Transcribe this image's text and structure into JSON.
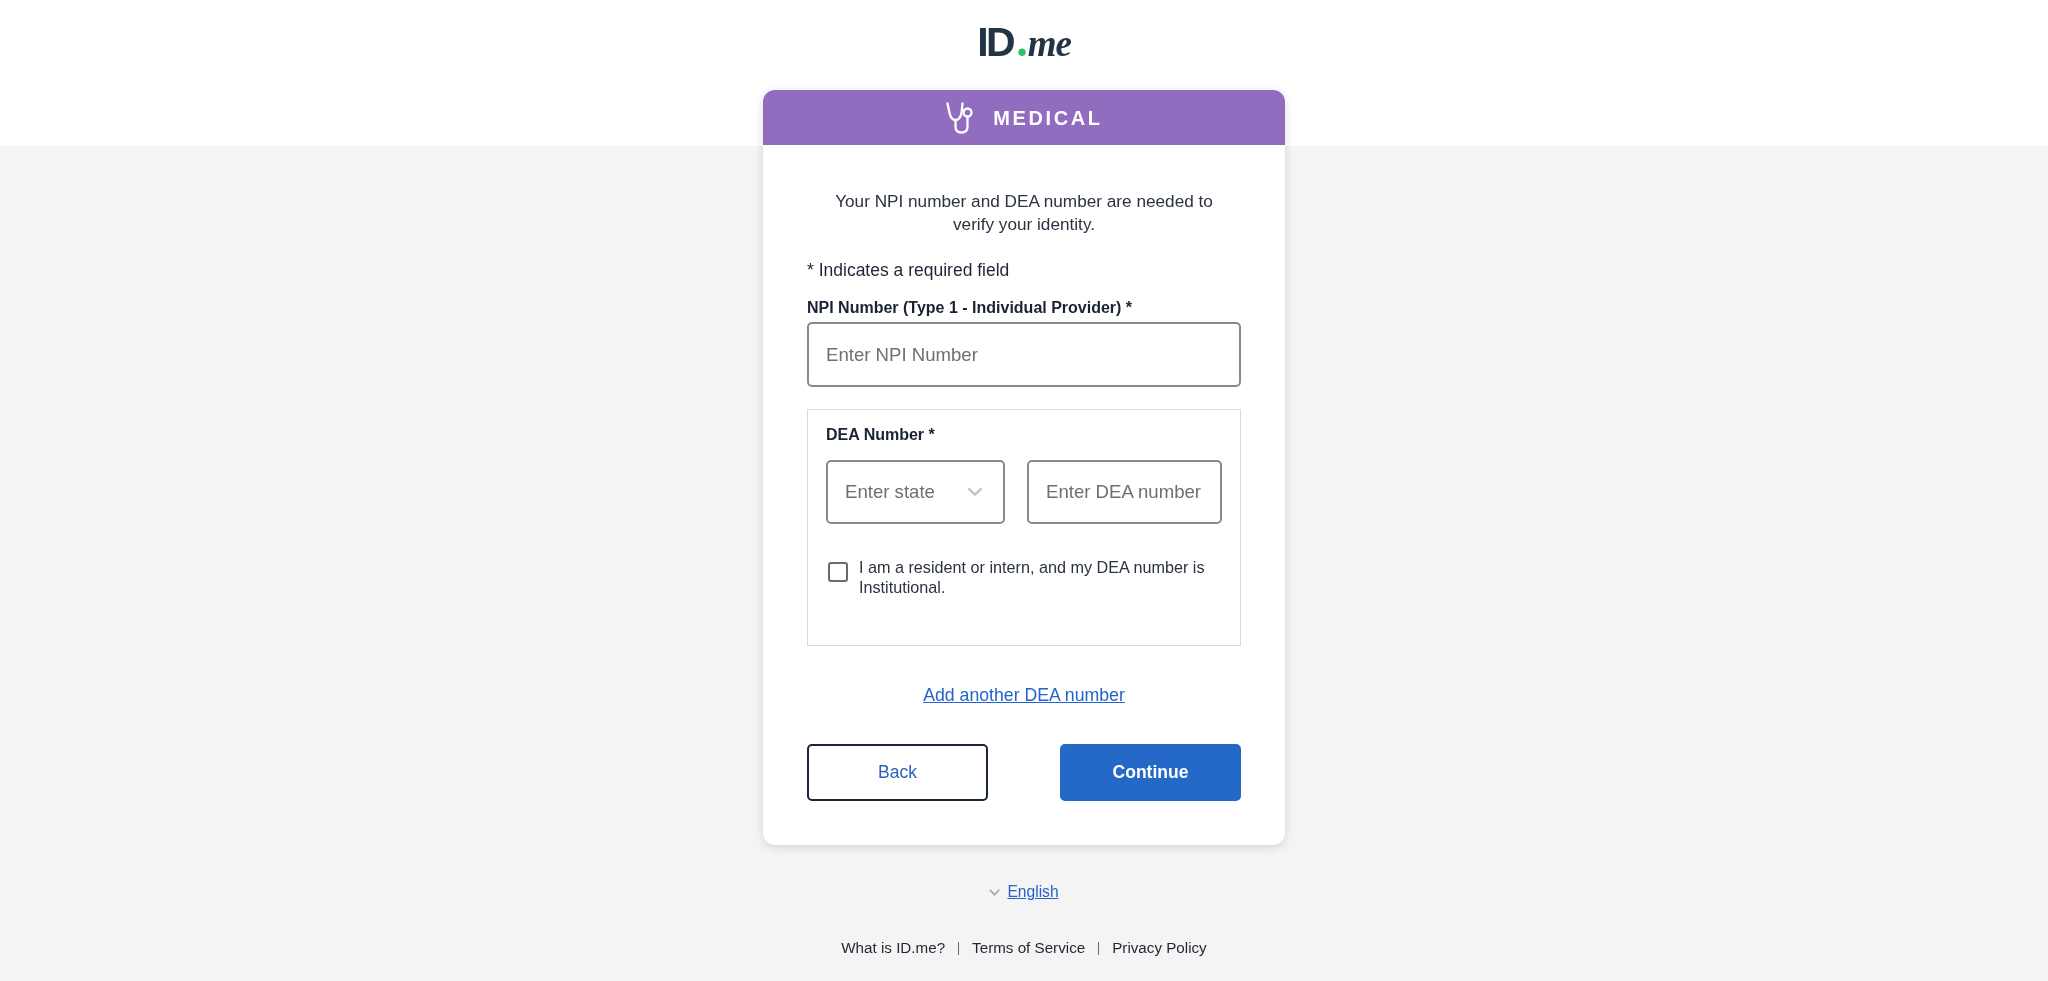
{
  "logo": {
    "main": "ID",
    "dot": ".",
    "suffix": "me"
  },
  "banner": {
    "title": "MEDICAL"
  },
  "intro": "Your NPI number and DEA number are needed to verify your identity.",
  "required_note": "* Indicates a required field",
  "npi_field": {
    "label": "NPI Number (Type 1 - Individual Provider) *",
    "placeholder": "Enter NPI Number"
  },
  "dea_group": {
    "label": "DEA Number *",
    "state_select": {
      "placeholder": "Enter state"
    },
    "dea_input": {
      "placeholder": "Enter DEA number"
    },
    "resident_checkbox": {
      "label": "I am a resident or intern, and my DEA number is Institutional.",
      "checked": false
    }
  },
  "add_link": "Add another DEA number",
  "buttons": [
    {
      "label": "Back",
      "kind": "secondary"
    },
    {
      "label": "Continue",
      "kind": "primary"
    }
  ],
  "language": {
    "label": "English"
  },
  "footer_links": [
    "What is ID.me?",
    "Terms of Service",
    "Privacy Policy"
  ]
}
